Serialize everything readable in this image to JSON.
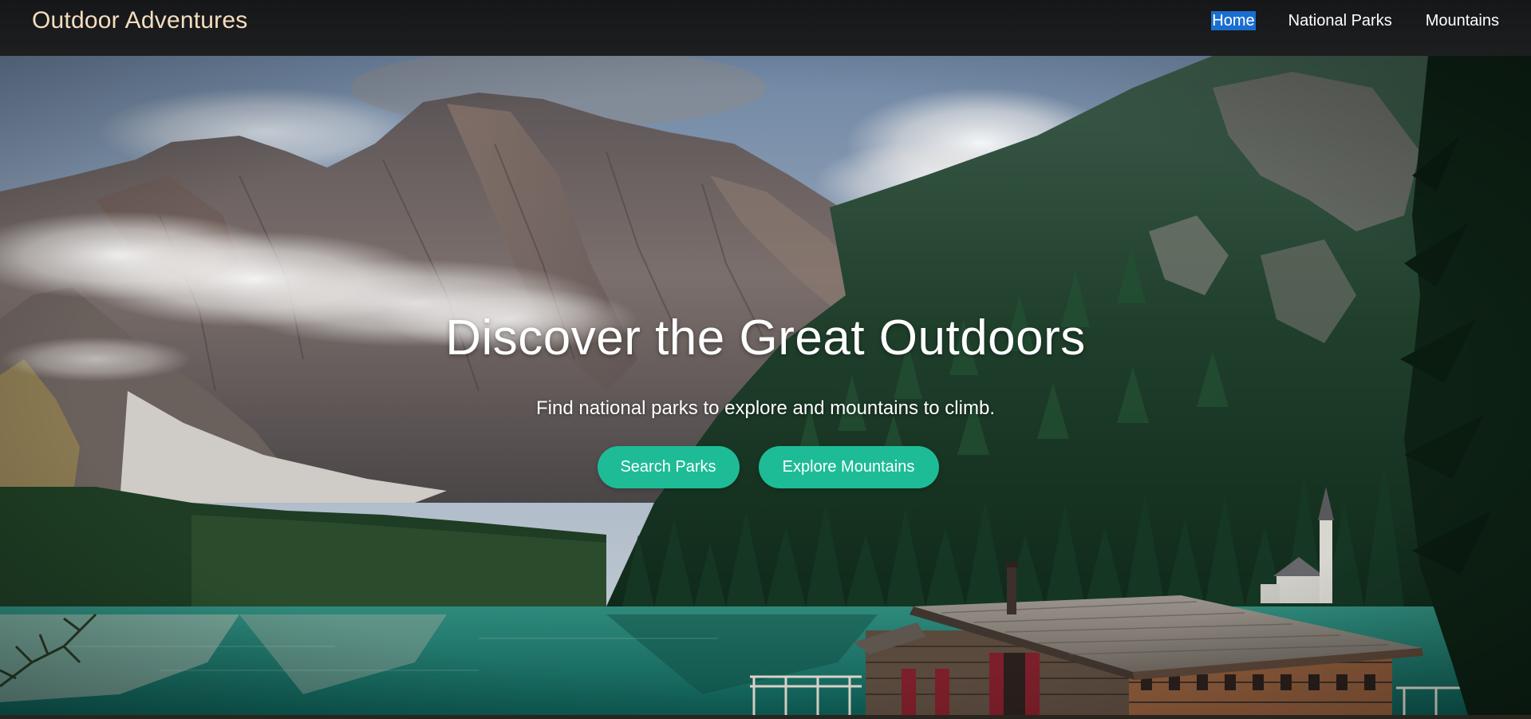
{
  "header": {
    "brand": "Outdoor Adventures",
    "nav": [
      {
        "label": "Home",
        "active": true
      },
      {
        "label": "National Parks",
        "active": false
      },
      {
        "label": "Mountains",
        "active": false
      }
    ]
  },
  "hero": {
    "title": "Discover the Great Outdoors",
    "subtitle": "Find national parks to explore and mountains to climb.",
    "buttons": {
      "search_parks": "Search Parks",
      "explore_mountains": "Explore Mountains"
    }
  },
  "colors": {
    "brand_text": "#f4ddc0",
    "header_bg": "#1a1b1d",
    "accent_button": "#1ebc96",
    "nav_active_highlight": "#1a6ed0"
  }
}
